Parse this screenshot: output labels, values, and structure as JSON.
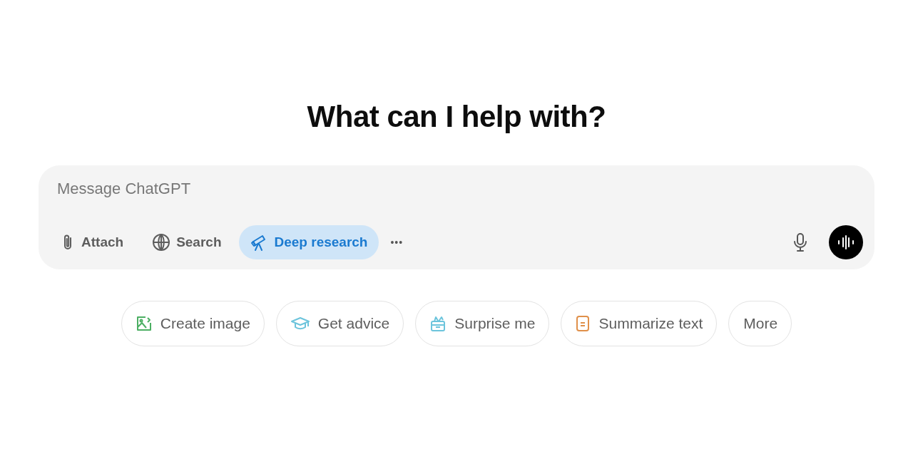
{
  "heading": "What can I help with?",
  "composer": {
    "placeholder": "Message ChatGPT",
    "tools": [
      {
        "kind": "attach",
        "label": "Attach",
        "selected": false
      },
      {
        "kind": "search",
        "label": "Search",
        "selected": false
      },
      {
        "kind": "research",
        "label": "Deep research",
        "selected": true
      }
    ],
    "more": "•••"
  },
  "suggestions": [
    {
      "kind": "image",
      "label": "Create image",
      "color": "#4caf63"
    },
    {
      "kind": "advice",
      "label": "Get advice",
      "color": "#6cc4dc"
    },
    {
      "kind": "surprise",
      "label": "Surprise me",
      "color": "#6cc4dc"
    },
    {
      "kind": "summarize",
      "label": "Summarize text",
      "color": "#e0904a"
    },
    {
      "kind": "text",
      "label": "More"
    }
  ]
}
